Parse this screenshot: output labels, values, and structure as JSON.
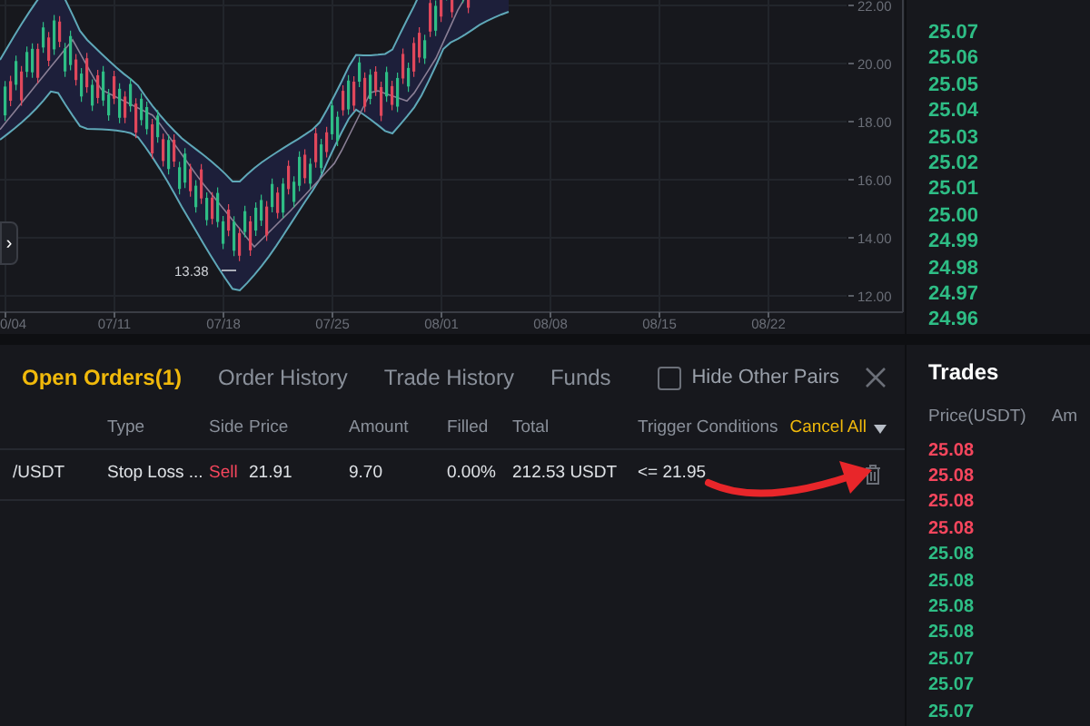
{
  "chart": {
    "y_axis": [
      "22.00",
      "20.00",
      "18.00",
      "16.00",
      "14.00",
      "12.00"
    ],
    "x_axis": [
      "0/04",
      "07/11",
      "07/18",
      "07/25",
      "08/01",
      "08/08",
      "08/15",
      "08/22"
    ],
    "low_label": "13.38",
    "expand_glyph": "›"
  },
  "order_book": {
    "prices": [
      "25.07",
      "25.06",
      "25.05",
      "25.04",
      "25.03",
      "25.02",
      "25.01",
      "25.00",
      "24.99",
      "24.98",
      "24.97",
      "24.96"
    ]
  },
  "tabs": [
    {
      "label": "Open Orders(1)",
      "selected": true
    },
    {
      "label": "Order History",
      "selected": false
    },
    {
      "label": "Trade History",
      "selected": false
    },
    {
      "label": "Funds",
      "selected": false
    }
  ],
  "hide_other_pairs": {
    "label": "Hide Other Pairs",
    "checked": false
  },
  "columns": [
    "",
    "Type",
    "Side",
    "Price",
    "Amount",
    "Filled",
    "Total",
    "Trigger Conditions"
  ],
  "cancel_all": "Cancel All",
  "orders": [
    {
      "cells": [
        "/USDT",
        "Stop Loss ...",
        "Sell",
        "21.91",
        "9.70",
        "0.00%",
        "212.53 USDT",
        "<= 21.95"
      ],
      "color": "#f6465d"
    }
  ],
  "trades": {
    "title": "Trades",
    "columns": [
      "Price(USDT)",
      "Am"
    ],
    "rows": [
      {
        "price": "25.08",
        "color": "#f6465d"
      },
      {
        "price": "25.08",
        "color": "#f6465d"
      },
      {
        "price": "25.08",
        "color": "#f6465d"
      },
      {
        "price": "25.08",
        "color": "#f6465d"
      },
      {
        "price": "25.08",
        "color": "#2ebd85"
      },
      {
        "price": "25.08",
        "color": "#2ebd85"
      },
      {
        "price": "25.08",
        "color": "#2ebd85"
      },
      {
        "price": "25.08",
        "color": "#2ebd85"
      },
      {
        "price": "25.07",
        "color": "#2ebd85"
      },
      {
        "price": "25.07",
        "color": "#2ebd85"
      },
      {
        "price": "25.07",
        "color": "#2ebd85"
      }
    ]
  }
}
